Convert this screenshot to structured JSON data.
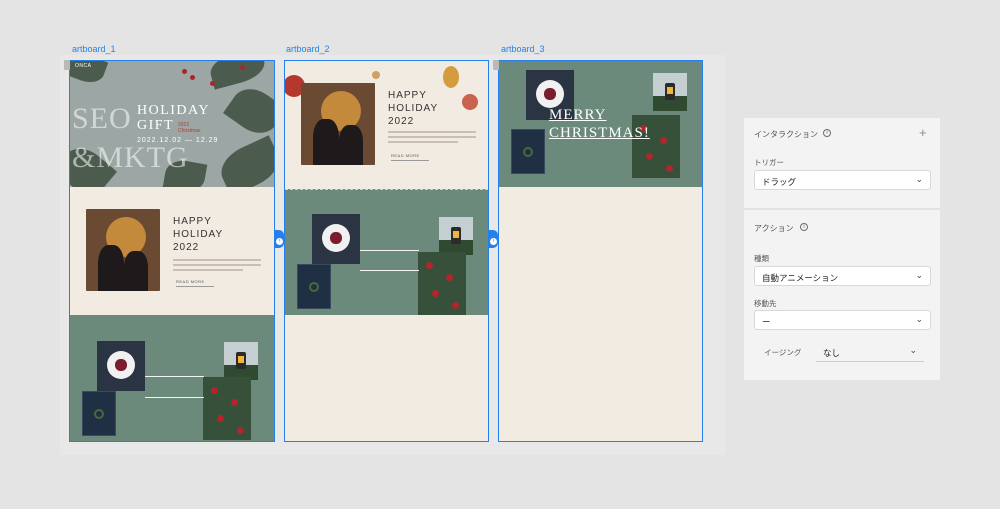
{
  "artboards": [
    {
      "label": "artboard_1"
    },
    {
      "label": "artboard_2"
    },
    {
      "label": "artboard_3"
    }
  ],
  "hero": {
    "brand": "ONCA",
    "deco_text_1": "SEO",
    "deco_text_2": "&MKTG",
    "title_1": "HOLIDAY",
    "title_2": "GIFT",
    "year": "2022",
    "sub": "Christmas",
    "dates": "2022.12.02 — 12.29"
  },
  "holiday": {
    "title_1": "HAPPY",
    "title_2": "HOLIDAY",
    "title_3": "2022",
    "read_more": "READ MORE"
  },
  "ab3": {
    "merry": "MERRY",
    "christmas": "CHRISTMAS!"
  },
  "panel": {
    "interaction_title": "インタラクション",
    "trigger_label": "トリガー",
    "trigger_value": "ドラッグ",
    "action_title": "アクション",
    "type_label": "種類",
    "type_value": "自動アニメーション",
    "destination_label": "移動先",
    "destination_value": "ー",
    "easing_label": "イージング",
    "easing_value": "なし"
  },
  "colors": {
    "selection": "#2680eb",
    "green": "#6b8a7c",
    "cream": "#f2ebe1"
  }
}
